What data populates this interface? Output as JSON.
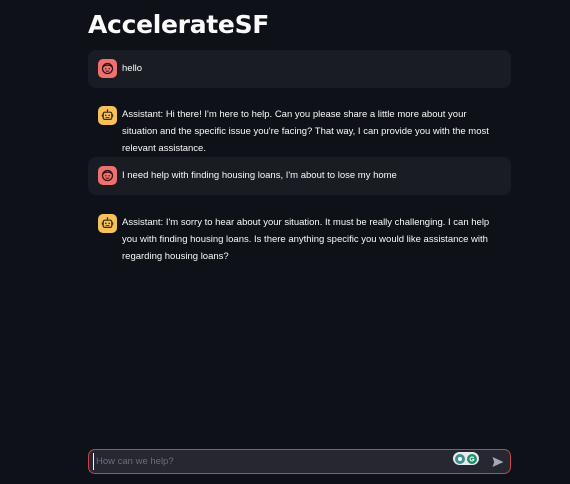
{
  "app": {
    "title": "AccelerateSF"
  },
  "messages": [
    {
      "role": "user",
      "avatar_icon": "user-face-icon",
      "text": "hello"
    },
    {
      "role": "assistant",
      "avatar_icon": "robot-icon",
      "text": "Assistant: Hi there! I'm here to help. Can you please share a little more about your situation and the specific issue you're facing? That way, I can provide you with the most relevant assistance."
    },
    {
      "role": "user",
      "avatar_icon": "user-face-icon",
      "text": "I need help with finding housing loans, I'm about to lose my home"
    },
    {
      "role": "assistant",
      "avatar_icon": "robot-icon",
      "text": "Assistant: I'm sorry to hear about your situation. It must be really challenging. I can help you with finding housing loans. Is there anything specific you would like assistance with regarding housing loans?"
    }
  ],
  "chat_input": {
    "placeholder": "How can we help?",
    "value": "",
    "send_icon": "send-icon"
  },
  "colors": {
    "background": "#0e1117",
    "user_bubble": "#1a1c24",
    "user_avatar": "#f0706f",
    "assistant_avatar": "#f7c159",
    "input_border": "#c4454d"
  }
}
